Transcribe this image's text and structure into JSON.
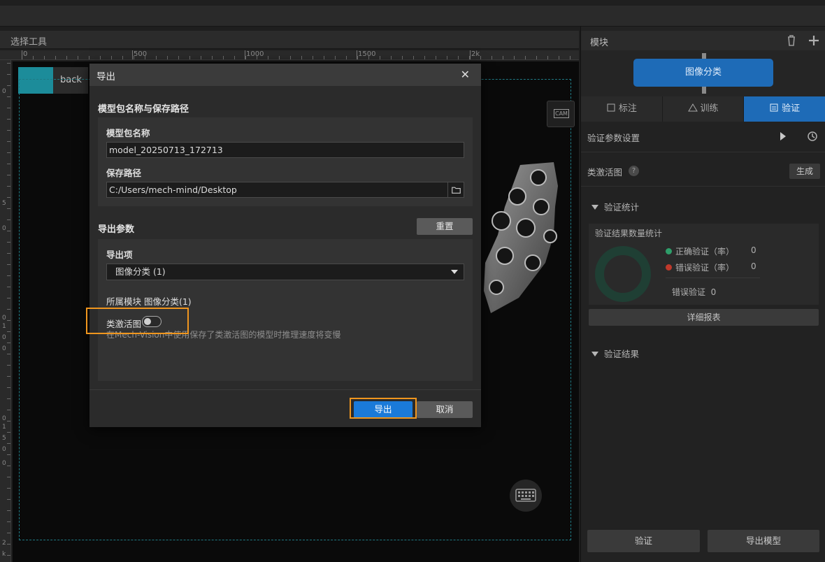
{
  "tool_panel": {
    "title": "选择工具",
    "ruler_labels": [
      "0",
      "500",
      "1000",
      "1500",
      "2k"
    ],
    "vruler_labels": [
      "0",
      "5",
      "0",
      "0",
      "1",
      "0",
      "0",
      "0",
      "1",
      "5",
      "0",
      "0",
      "2",
      "k"
    ],
    "back_label": "back",
    "cam_label": "CAM"
  },
  "right_panel": {
    "title": "模块",
    "module_node": "图像分类",
    "tabs": [
      {
        "label": "标注",
        "icon": "annotate-icon"
      },
      {
        "label": "训练",
        "icon": "train-icon"
      },
      {
        "label": "验证",
        "icon": "validate-icon"
      }
    ],
    "validation_settings_label": "验证参数设置",
    "cam_label": "类激活图",
    "help_glyph": "?",
    "generate_label": "生成",
    "stats_section": "验证统计",
    "stats_title": "验证结果数量统计",
    "correct_label": "正确验证（率）",
    "correct_value": "0",
    "wrong_label": "错误验证（率）",
    "wrong_value": "0",
    "wrong_total_label": "错误验证",
    "wrong_total_value": "0",
    "detail_report": "详细报表",
    "results_section": "验证结果",
    "validate_button": "验证",
    "export_model_button": "导出模型",
    "colors": {
      "correct": "#2e9e6a",
      "wrong": "#c0392b",
      "accent": "#1e6bb7"
    }
  },
  "dialog": {
    "title": "导出",
    "close_glyph": "✕",
    "name_path_section": "模型包名称与保存路径",
    "package_name_label": "模型包名称",
    "package_name_value": "model_20250713_172713",
    "save_path_label": "保存路径",
    "save_path_value": "C:/Users/mech-mind/Desktop",
    "export_params_section": "导出参数",
    "reset_button": "重置",
    "export_item_label": "导出项",
    "export_item_value": "图像分类 (1)",
    "module_line": "所属模块 图像分类(1)",
    "cam_toggle_label": "类激活图",
    "cam_toggle_on": false,
    "cam_hint": "在Mech-Vision中使用保存了类激活图的模型时推理速度将变慢",
    "export_button": "导出",
    "cancel_button": "取消"
  }
}
